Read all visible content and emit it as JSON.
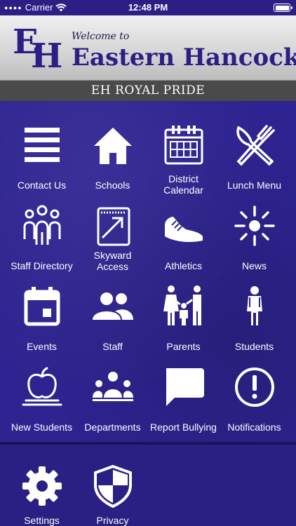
{
  "status_bar": {
    "carrier": "Carrier",
    "time": "12:48 PM"
  },
  "banner": {
    "logo_e": "E",
    "logo_h": "H",
    "welcome": "Welcome to",
    "school_name": "Eastern Hancock"
  },
  "subtitle": "EH ROYAL PRIDE",
  "tiles": [
    {
      "label": "Contact Us",
      "icon": "menu-lines-icon"
    },
    {
      "label": "Schools",
      "icon": "home-icon"
    },
    {
      "label_line1": "District",
      "label_line2": "Calendar",
      "icon": "calendar-icon"
    },
    {
      "label": "Lunch Menu",
      "icon": "knife-fork-icon"
    },
    {
      "label": "Staff Directory",
      "icon": "people-group-icon"
    },
    {
      "label_line1": "Skyward",
      "label_line2": "Access",
      "icon": "external-link-icon"
    },
    {
      "label": "Athletics",
      "icon": "sneaker-icon"
    },
    {
      "label": "News",
      "icon": "sun-icon"
    },
    {
      "label": "Events",
      "icon": "calendar-day-icon"
    },
    {
      "label": "Staff",
      "icon": "users-icon"
    },
    {
      "label": "Parents",
      "icon": "family-icon"
    },
    {
      "label": "Students",
      "icon": "student-icon"
    },
    {
      "label": "New Students",
      "icon": "apple-icon"
    },
    {
      "label": "Departments",
      "icon": "team-icon"
    },
    {
      "label": "Report Bullying",
      "icon": "chat-bubble-icon"
    },
    {
      "label": "Notifications",
      "icon": "exclamation-circle-icon"
    }
  ],
  "bottom": [
    {
      "label": "Settings",
      "icon": "gear-icon"
    },
    {
      "label": "Privacy",
      "icon": "shield-icon"
    }
  ],
  "colors": {
    "primary": "#2b1f86",
    "subtitle_bar": "#4a4a4a",
    "icon": "#ffffff"
  }
}
